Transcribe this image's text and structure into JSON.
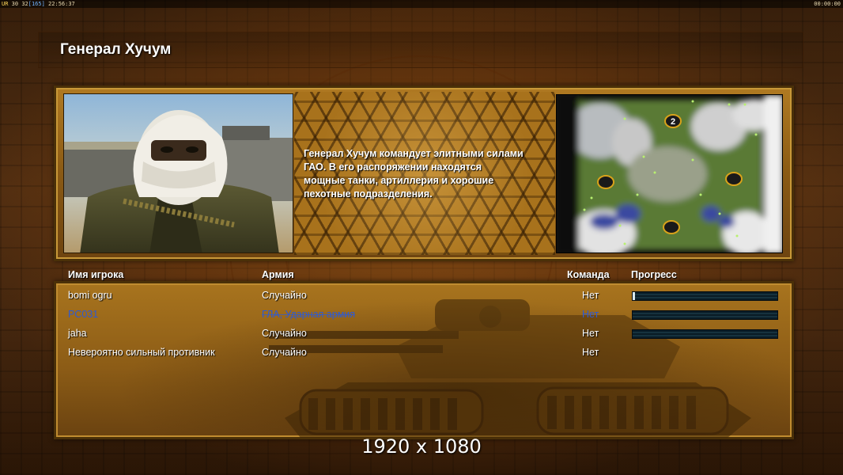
{
  "hud": {
    "ur_label": "UR",
    "fps": "30",
    "fps2": "32",
    "frame": "[165]",
    "clock": "22:56:37",
    "timer": "00:00:00"
  },
  "general": {
    "title": "Генерал Хучум",
    "description": "Генерал Хучум командует элитными силами\n ГАО. В его распоряжении находятся\n мощные танки, артиллерия и хорошие\n пехотные подразделения."
  },
  "minimap": {
    "slot_label": "2"
  },
  "players_table": {
    "headers": {
      "name": "Имя игрока",
      "army": "Армия",
      "team": "Команда",
      "progress": "Прогресс"
    },
    "rows": [
      {
        "name": "bomi ogru",
        "army": "Случайно",
        "team": "Нет",
        "progress": 0.01,
        "show_bar": true
      },
      {
        "name": "PC031",
        "army": "ГЛА, Ударная армия",
        "team": "Нет",
        "progress": 0.0,
        "show_bar": true
      },
      {
        "name": "jaha",
        "army": "Случайно",
        "team": "Нет",
        "progress": 0.0,
        "show_bar": true
      },
      {
        "name": "Невероятно сильный противник",
        "army": "Случайно",
        "team": "Нет",
        "progress": 0.0,
        "show_bar": false
      }
    ]
  },
  "watermark": "1920 x 1080",
  "colors": {
    "human_player": "#2c5ad6",
    "text": "#ffffff",
    "panel_gold": "#a8741e"
  }
}
